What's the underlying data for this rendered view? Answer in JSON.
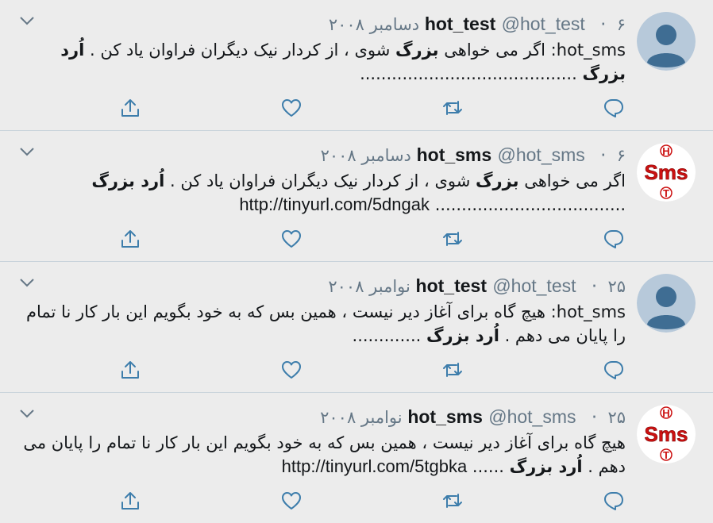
{
  "colors": {
    "background": "#ececec",
    "divider": "#c9d3db",
    "secondary_text": "#657786",
    "icon": "#3d7dab"
  },
  "tweets": [
    {
      "name": "hot_test",
      "handle": "@hot_test",
      "date": "۶ دسامبر ۲۰۰۸",
      "avatar": "default-avatar-icon",
      "text": {
        "p1": "hot_sms: اگر می خواهی ",
        "b1": "بزرگ",
        "p2": " شوی ، از کردار نیک دیگران فراوان یاد کن . ",
        "b2": "اُرد بزرگ",
        "p3": " .........................................",
        "link": ""
      }
    },
    {
      "name": "hot_sms",
      "handle": "@hot_sms",
      "date": "۶ دسامبر ۲۰۰۸",
      "avatar": "sms-logo-icon",
      "text": {
        "p1": "اگر می خواهی ",
        "b1": "بزرگ",
        "p2": " شوی ، از کردار نیک دیگران فراوان یاد کن . ",
        "b2": "اُرد بزرگ",
        "p3": " ....................................",
        "link": "http://tinyurl.com/5dngak"
      }
    },
    {
      "name": "hot_test",
      "handle": "@hot_test",
      "date": "۲۵ نوامبر ۲۰۰۸",
      "avatar": "default-avatar-icon",
      "text": {
        "p1": "hot_sms: هیچ گاه برای آغاز دیر نیست ، همین بس که به خود بگویم این بار کار نا تمام را پایان می دهم . ",
        "b1": "اُرد بزرگ",
        "p2": " .............",
        "b2": "",
        "p3": "",
        "link": ""
      }
    },
    {
      "name": "hot_sms",
      "handle": "@hot_sms",
      "date": "۲۵ نوامبر ۲۰۰۸",
      "avatar": "sms-logo-icon",
      "text": {
        "p1": "هیچ گاه برای آغاز دیر نیست ، همین بس که به خود بگویم این بار کار نا تمام را پایان می دهم . ",
        "b1": "اُرد بزرگ",
        "p2": " ......",
        "b2": "",
        "p3": "",
        "link": "http://tinyurl.com/5tgbka"
      }
    }
  ],
  "sms_logo": {
    "top": "H",
    "middle": "Sms",
    "bottom": "T"
  }
}
